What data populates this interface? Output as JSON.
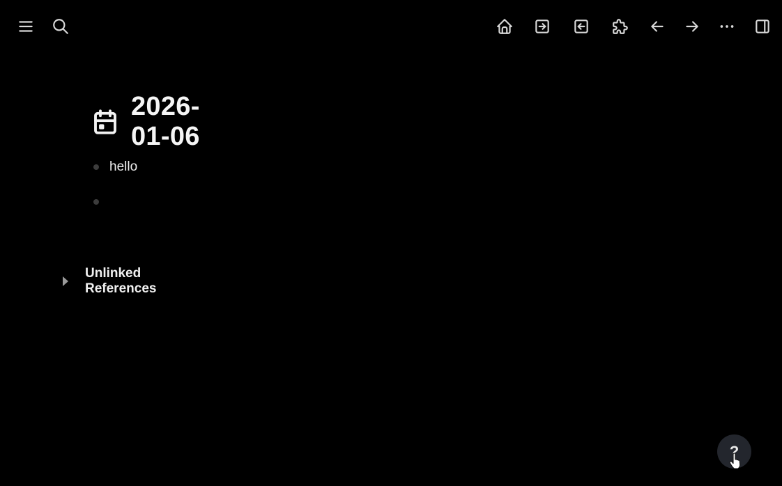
{
  "toolbar": {
    "left_icons": [
      "menu-icon",
      "search-icon"
    ],
    "right_icons": [
      "home-icon",
      "arrow-right-box-icon",
      "arrow-left-box-icon",
      "puzzle-icon",
      "arrow-left-icon",
      "arrow-right-icon",
      "more-horizontal-icon",
      "right-sidebar-icon"
    ]
  },
  "page": {
    "title": "2026-01-06",
    "title_icon": "calendar-icon",
    "blocks": [
      "hello",
      ""
    ]
  },
  "references": {
    "label": "Unlinked References"
  },
  "help": {
    "label": "?"
  },
  "colors": {
    "background": "#000000",
    "text": "#f0f0f0",
    "icon": "#d8d8d8",
    "bullet": "#3c3c3c",
    "help_button": "#23262d"
  }
}
